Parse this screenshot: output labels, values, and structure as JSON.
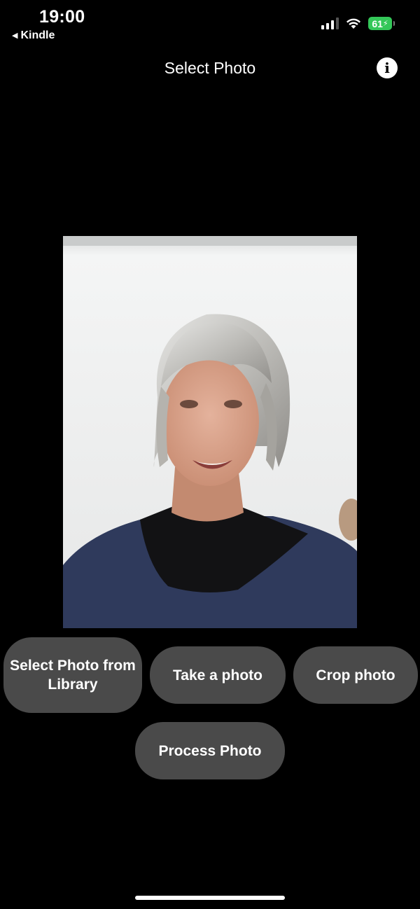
{
  "status_bar": {
    "time": "19:00",
    "back_app": "Kindle",
    "battery": "61"
  },
  "nav": {
    "title": "Select Photo",
    "info_icon": "info-circle-icon"
  },
  "photo": {
    "subject": "selected-photo"
  },
  "buttons": {
    "select_library": "Select Photo from Library",
    "take_photo": "Take a photo",
    "crop_photo": "Crop photo",
    "process_photo": "Process Photo"
  },
  "colors": {
    "background": "#000000",
    "button_bg": "#4a4a4a",
    "battery": "#34c759"
  }
}
